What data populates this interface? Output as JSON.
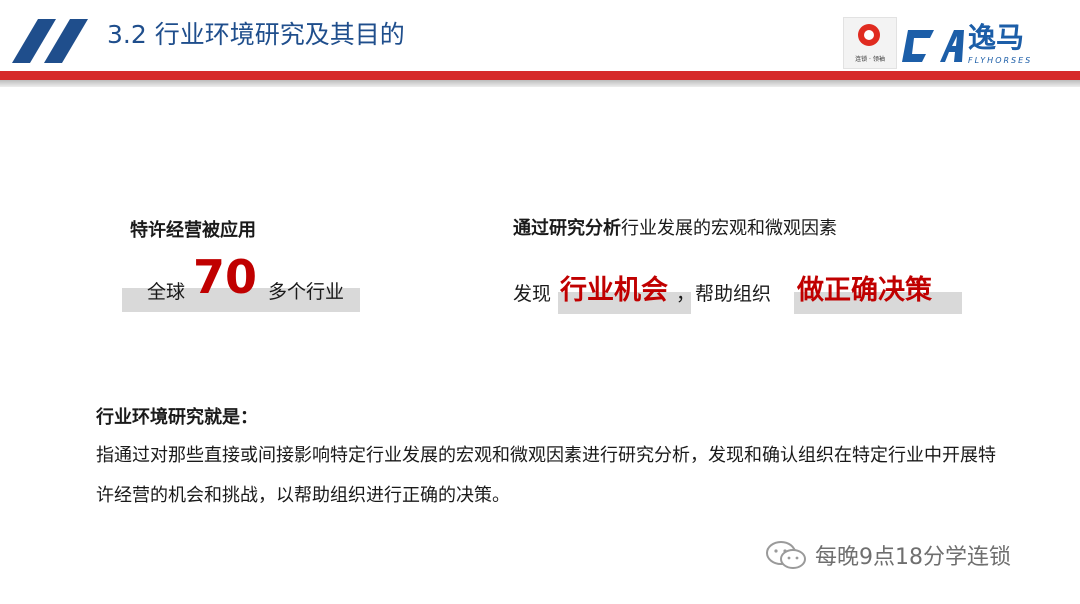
{
  "header": {
    "title": "3.2 行业环境研究及其目的",
    "logo_left_caption": "连锁 · 领袖",
    "logo_right_name": "逸马",
    "logo_right_sub": "FLYHORSES"
  },
  "left_block": {
    "title": "特许经营被应用",
    "prefix": "全球",
    "number": "70",
    "suffix": "多个行业"
  },
  "right_block": {
    "line1_bold": "通过研究分析",
    "line1_rest": "行业发展的宏观和微观因素",
    "line2_lead": "发现",
    "line2_em1": "行业机会",
    "line2_mid": "，帮助组织",
    "line2_em2": "做正确决策"
  },
  "definition": {
    "heading": "行业环境研究就是：",
    "body": "指通过对那些直接或间接影响特定行业发展的宏观和微观因素进行研究分析，发现和确认组织在特定行业中开展特许经营的机会和挑战，以帮助组织进行正确的决策。"
  },
  "watermark": {
    "text": "每晚9点18分学连锁"
  },
  "colors": {
    "title_blue": "#1f4e8c",
    "accent_red": "#c00000",
    "band_gray": "#d9d9d9",
    "header_red": "#d62a2a"
  }
}
